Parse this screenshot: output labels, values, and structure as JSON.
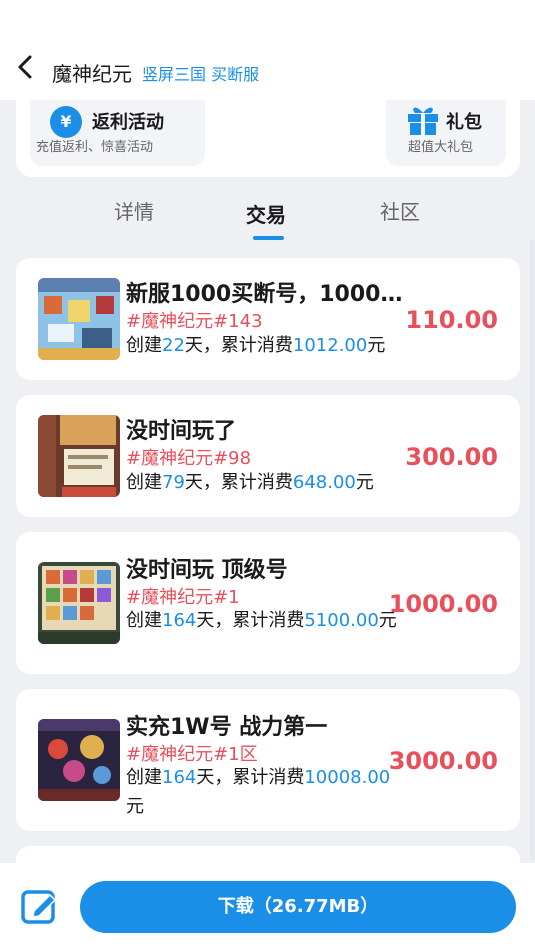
{
  "header": {
    "title": "魔神纪元",
    "subtitle": "竖屏三国 买断服"
  },
  "promo": {
    "rebate_title": "返利活动",
    "rebate_desc": "充值返利、惊喜活动",
    "gift_title": "礼包",
    "gift_desc": "超值大礼包"
  },
  "tabs": [
    {
      "label": "详情"
    },
    {
      "label": "交易"
    },
    {
      "label": "社区"
    }
  ],
  "listings": [
    {
      "title": "新服1000买断号，1000…",
      "tag": "#魔神纪元#143",
      "created_prefix": "创建",
      "days": "22",
      "mid": "天，累计消费",
      "spent": "1012.00",
      "suffix": "元",
      "price": "110.00"
    },
    {
      "title": "没时间玩了",
      "tag": "#魔神纪元#98",
      "created_prefix": "创建",
      "days": "79",
      "mid": "天，累计消费",
      "spent": "648.00",
      "suffix": "元",
      "price": "300.00"
    },
    {
      "title": "没时间玩 顶级号",
      "tag": "#魔神纪元#1",
      "created_prefix": "创建",
      "days": "164",
      "mid": "天，累计消费",
      "spent": "5100.00",
      "suffix": "元",
      "price": "1000.00"
    },
    {
      "title": "实充1W号 战力第一",
      "tag": "#魔神纪元#1区",
      "created_prefix": "创建",
      "days": "164",
      "mid": "天，累计消费",
      "spent": "10008.00",
      "suffix": "元",
      "price": "3000.00"
    }
  ],
  "bottom": {
    "download_label": "下载（26.77MB）"
  },
  "colors": {
    "accent": "#1b8fe8",
    "price": "#e8505b"
  }
}
